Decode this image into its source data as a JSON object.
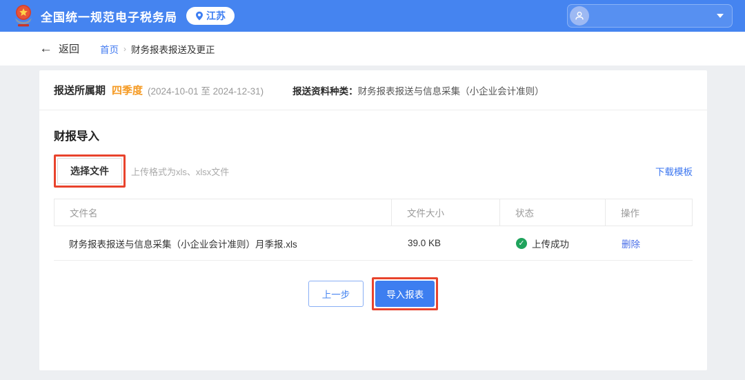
{
  "colors": {
    "header_blue": "#4584f0",
    "link_blue": "#3d77f0",
    "period_orange": "#f59a23",
    "success_green": "#1fa35c",
    "annotation_red": "#e8432c"
  },
  "icons": {
    "back_arrow": "←",
    "breadcrumb_separator": "›",
    "check": "✓"
  },
  "header": {
    "app_title": "全国统一规范电子税务局",
    "location_badge": "江苏",
    "user_name": ""
  },
  "breadcrumb": {
    "back_label": "返回",
    "items": [
      {
        "label": "首页"
      },
      {
        "label": "财务报表报送及更正"
      }
    ]
  },
  "period_bar": {
    "label": "报送所属期",
    "period": "四季度",
    "range": "(2024-10-01 至 2024-12-31)",
    "type_label": "报送资料种类：",
    "type_value": "财务报表报送与信息采集（小企业会计准则）"
  },
  "import_section": {
    "title": "财报导入",
    "choose_file_label": "选择文件",
    "format_hint": "上传格式为xls、xlsx文件",
    "download_template_label": "下载模板"
  },
  "file_table": {
    "columns": [
      "文件名",
      "文件大小",
      "状态",
      "操作"
    ],
    "rows": [
      {
        "name": "财务报表报送与信息采集（小企业会计准则）月季报.xls",
        "size": "39.0 KB",
        "status": "上传成功",
        "action": "删除"
      }
    ]
  },
  "footer_buttons": {
    "prev_label": "上一步",
    "import_label": "导入报表"
  }
}
